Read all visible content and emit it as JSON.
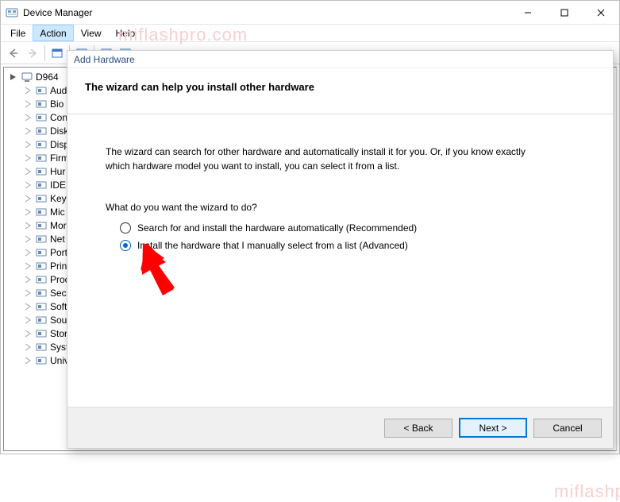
{
  "window": {
    "title": "Device Manager"
  },
  "menu": {
    "file": "File",
    "action": "Action",
    "view": "View",
    "help": "Help"
  },
  "tree": {
    "root": "D964",
    "items": [
      {
        "label": "Aud",
        "icon": "audio-icon"
      },
      {
        "label": "Bio",
        "icon": "biometric-icon"
      },
      {
        "label": "Con",
        "icon": "computer-icon"
      },
      {
        "label": "Disk",
        "icon": "disk-icon"
      },
      {
        "label": "Disp",
        "icon": "display-icon"
      },
      {
        "label": "Firm",
        "icon": "firmware-icon"
      },
      {
        "label": "Hur",
        "icon": "hid-icon"
      },
      {
        "label": "IDE",
        "icon": "ide-icon"
      },
      {
        "label": "Keyl",
        "icon": "keyboard-icon"
      },
      {
        "label": "Mic",
        "icon": "mouse-icon"
      },
      {
        "label": "Mor",
        "icon": "monitor-icon"
      },
      {
        "label": "Net",
        "icon": "network-icon"
      },
      {
        "label": "Port",
        "icon": "port-icon"
      },
      {
        "label": "Prin",
        "icon": "printer-icon"
      },
      {
        "label": "Proc",
        "icon": "processor-icon"
      },
      {
        "label": "Secu",
        "icon": "security-icon"
      },
      {
        "label": "Soft",
        "icon": "software-icon"
      },
      {
        "label": "Sou",
        "icon": "sound-icon"
      },
      {
        "label": "Stor",
        "icon": "storage-icon"
      },
      {
        "label": "Syst",
        "icon": "system-icon"
      },
      {
        "label": "Univ",
        "icon": "usb-icon"
      }
    ]
  },
  "dialog": {
    "title": "Add Hardware",
    "heading": "The wizard can help you install other hardware",
    "intro": "The wizard can search for other hardware and automatically install it for you. Or, if you know exactly which hardware model you want to install, you can select it from a list.",
    "prompt": "What do you want the wizard to do?",
    "option_auto": "Search for and install the hardware automatically (Recommended)",
    "option_manual": "Install the hardware that I manually select from a list (Advanced)",
    "selected": "manual",
    "buttons": {
      "back": "< Back",
      "next": "Next >",
      "cancel": "Cancel"
    }
  },
  "watermark": "miflashpro.com"
}
